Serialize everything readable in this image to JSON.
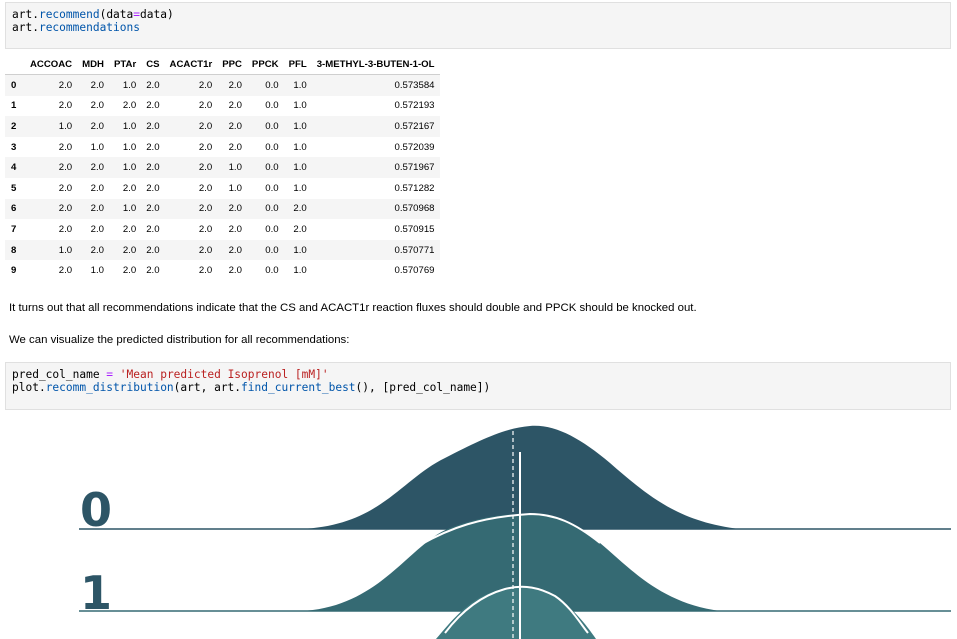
{
  "cell1": {
    "line1": {
      "a": "art.",
      "fn": "recommend",
      "b": "(data",
      "op": "=",
      "c": "data)"
    },
    "line2": {
      "a": "art.",
      "fn": "recommendations"
    }
  },
  "table": {
    "columns": [
      "",
      "ACCOAC",
      "MDH",
      "PTAr",
      "CS",
      "ACACT1r",
      "PPC",
      "PPCK",
      "PFL",
      "3-METHYL-3-BUTEN-1-OL"
    ],
    "rows": [
      [
        "0",
        "2.0",
        "2.0",
        "1.0",
        "2.0",
        "2.0",
        "2.0",
        "0.0",
        "1.0",
        "0.573584"
      ],
      [
        "1",
        "2.0",
        "2.0",
        "2.0",
        "2.0",
        "2.0",
        "2.0",
        "0.0",
        "1.0",
        "0.572193"
      ],
      [
        "2",
        "1.0",
        "2.0",
        "1.0",
        "2.0",
        "2.0",
        "2.0",
        "0.0",
        "1.0",
        "0.572167"
      ],
      [
        "3",
        "2.0",
        "1.0",
        "1.0",
        "2.0",
        "2.0",
        "2.0",
        "0.0",
        "1.0",
        "0.572039"
      ],
      [
        "4",
        "2.0",
        "2.0",
        "1.0",
        "2.0",
        "2.0",
        "1.0",
        "0.0",
        "1.0",
        "0.571967"
      ],
      [
        "5",
        "2.0",
        "2.0",
        "2.0",
        "2.0",
        "2.0",
        "1.0",
        "0.0",
        "1.0",
        "0.571282"
      ],
      [
        "6",
        "2.0",
        "2.0",
        "1.0",
        "2.0",
        "2.0",
        "2.0",
        "0.0",
        "2.0",
        "0.570968"
      ],
      [
        "7",
        "2.0",
        "2.0",
        "2.0",
        "2.0",
        "2.0",
        "2.0",
        "0.0",
        "2.0",
        "0.570915"
      ],
      [
        "8",
        "1.0",
        "2.0",
        "2.0",
        "2.0",
        "2.0",
        "2.0",
        "0.0",
        "1.0",
        "0.570771"
      ],
      [
        "9",
        "2.0",
        "1.0",
        "2.0",
        "2.0",
        "2.0",
        "2.0",
        "0.0",
        "1.0",
        "0.570769"
      ]
    ]
  },
  "text": {
    "p1": "It turns out that all recommendations indicate that the CS and ACACT1r reaction fluxes should double and PPCK should be knocked out.",
    "p2": "We can visualize the predicted distribution for all recommendations:"
  },
  "cell2": {
    "line1": {
      "a": "pred_col_name ",
      "op": "=",
      "sp": " ",
      "str": "'Mean predicted Isoprenol [mM]'"
    },
    "line2": {
      "a": "plot.",
      "fn1": "recomm_distribution",
      "b": "(art, art.",
      "fn2": "find_current_best",
      "c": "(), [pred_col_name])"
    }
  },
  "plot": {
    "labels": [
      "0",
      "1"
    ],
    "colors": {
      "ridge0": "#2d5566",
      "ridge1": "#356a73",
      "ridge2": "#3f7a80",
      "label": "#2d5566"
    }
  }
}
